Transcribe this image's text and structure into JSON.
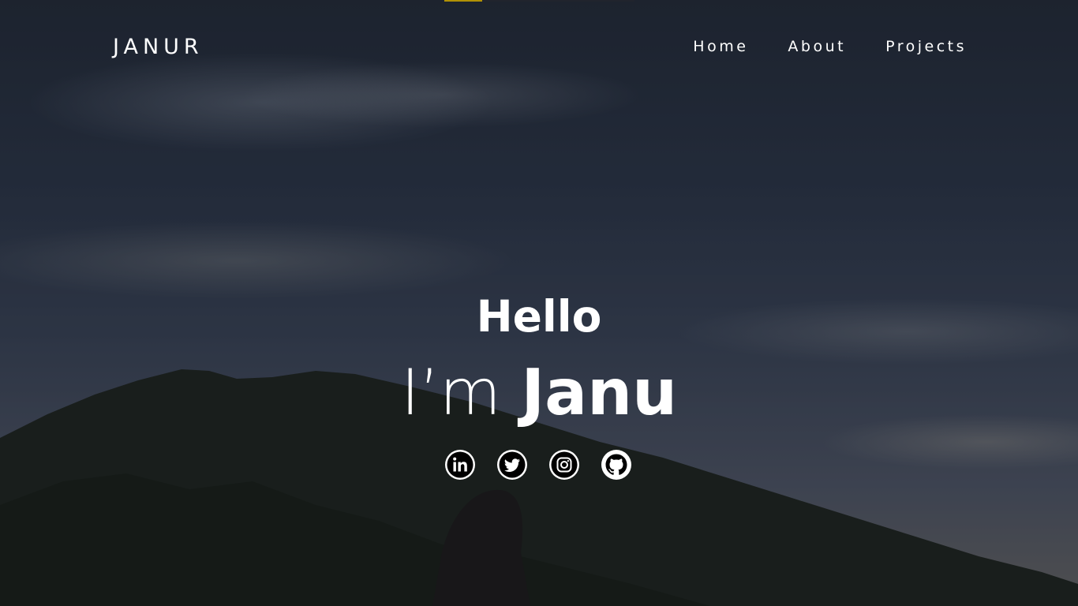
{
  "brand": {
    "name": "JANUR"
  },
  "nav": {
    "items": [
      {
        "label": "Home"
      },
      {
        "label": "About"
      },
      {
        "label": "Projects"
      }
    ]
  },
  "hero": {
    "greeting": "Hello",
    "intro_prefix": "I’m ",
    "intro_name": "Janu"
  },
  "socials": [
    {
      "icon": "linkedin-icon"
    },
    {
      "icon": "twitter-icon"
    },
    {
      "icon": "instagram-icon"
    },
    {
      "icon": "github-icon"
    }
  ],
  "colors": {
    "accent": "#f2c500",
    "text": "#ffffff",
    "icon_bg": "#ffffff",
    "icon_fg": "#000000"
  }
}
